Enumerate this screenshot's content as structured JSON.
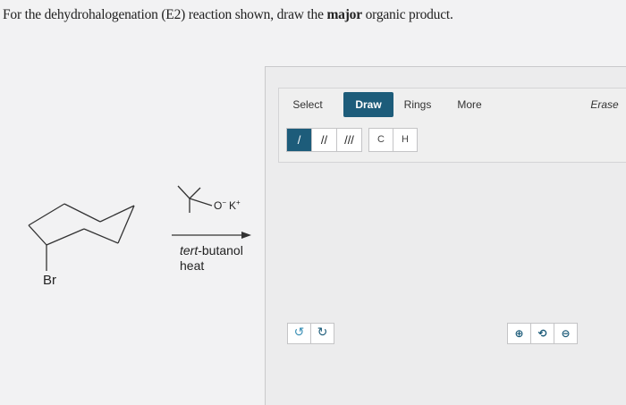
{
  "question": {
    "prefix": "For the dehydrohalogenation (E2) reaction shown, draw the ",
    "emphasis": "major",
    "suffix": " organic product."
  },
  "reaction": {
    "substrate_label": "Br",
    "base_anion": "O",
    "base_anion_charge": "−",
    "base_cation": "K",
    "base_cation_charge": "+",
    "solvent_italic": "tert",
    "solvent_rest": "-butanol",
    "condition": "heat"
  },
  "tabs": {
    "select": "Select",
    "draw": "Draw",
    "rings": "Rings",
    "more": "More",
    "erase": "Erase"
  },
  "bond_tools": [
    "/",
    "//",
    "///"
  ],
  "atom_tools": [
    "C",
    "H"
  ],
  "history": {
    "undo": "↺",
    "redo": "↻"
  },
  "zoom": {
    "zoom_in": "⊕",
    "reset": "⟲",
    "zoom_out": "⊖"
  },
  "colors": {
    "accent": "#1d5c7a",
    "background": "#f2f2f3"
  }
}
